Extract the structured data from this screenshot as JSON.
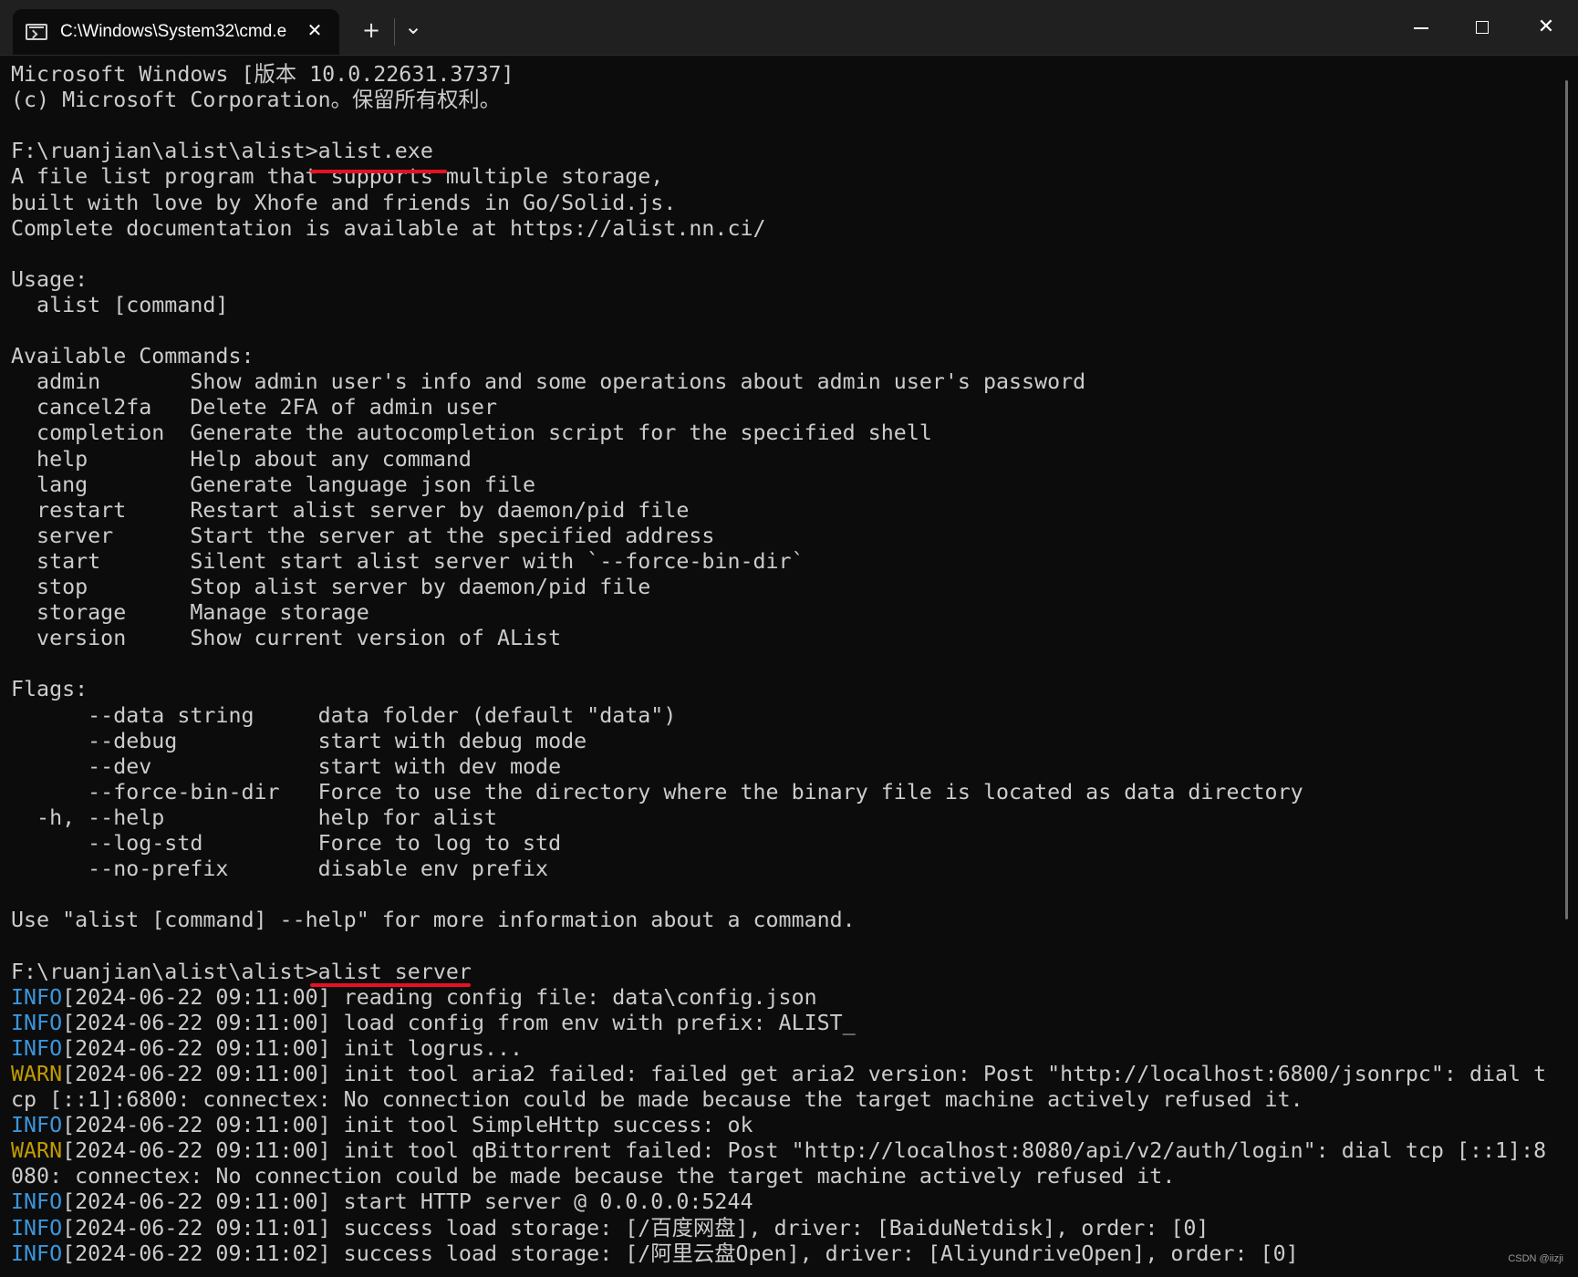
{
  "window": {
    "tab_title": "C:\\Windows\\System32\\cmd.e",
    "tab_close": "✕",
    "new_tab": "+",
    "dropdown": "⌄",
    "close": "✕"
  },
  "colors": {
    "background": "#0c0c0c",
    "text": "#cccccc",
    "info": "#3a96dd",
    "warn": "#c19c00",
    "highlight": "#e81123"
  },
  "terminal": {
    "lines": [
      {
        "text": "Microsoft Windows [版本 10.0.22631.3737]"
      },
      {
        "text": "(c) Microsoft Corporation。保留所有权利。"
      },
      {
        "text": ""
      },
      {
        "text": "F:\\ruanjian\\alist\\alist>alist.exe"
      },
      {
        "text": "A file list program that supports multiple storage,"
      },
      {
        "text": "built with love by Xhofe and friends in Go/Solid.js."
      },
      {
        "text": "Complete documentation is available at https://alist.nn.ci/"
      },
      {
        "text": ""
      },
      {
        "text": "Usage:"
      },
      {
        "text": "  alist [command]"
      },
      {
        "text": ""
      },
      {
        "text": "Available Commands:"
      },
      {
        "text": "  admin       Show admin user's info and some operations about admin user's password"
      },
      {
        "text": "  cancel2fa   Delete 2FA of admin user"
      },
      {
        "text": "  completion  Generate the autocompletion script for the specified shell"
      },
      {
        "text": "  help        Help about any command"
      },
      {
        "text": "  lang        Generate language json file"
      },
      {
        "text": "  restart     Restart alist server by daemon/pid file"
      },
      {
        "text": "  server      Start the server at the specified address"
      },
      {
        "text": "  start       Silent start alist server with `--force-bin-dir`"
      },
      {
        "text": "  stop        Stop alist server by daemon/pid file"
      },
      {
        "text": "  storage     Manage storage"
      },
      {
        "text": "  version     Show current version of AList"
      },
      {
        "text": ""
      },
      {
        "text": "Flags:"
      },
      {
        "text": "      --data string     data folder (default \"data\")"
      },
      {
        "text": "      --debug           start with debug mode"
      },
      {
        "text": "      --dev             start with dev mode"
      },
      {
        "text": "      --force-bin-dir   Force to use the directory where the binary file is located as data directory"
      },
      {
        "text": "  -h, --help            help for alist"
      },
      {
        "text": "      --log-std         Force to log to std"
      },
      {
        "text": "      --no-prefix       disable env prefix"
      },
      {
        "text": ""
      },
      {
        "text": "Use \"alist [command] --help\" for more information about a command."
      },
      {
        "text": ""
      },
      {
        "text": "F:\\ruanjian\\alist\\alist>alist server"
      },
      {
        "level": "INFO",
        "text": "[2024-06-22 09:11:00] reading config file: data\\config.json"
      },
      {
        "level": "INFO",
        "text": "[2024-06-22 09:11:00] load config from env with prefix: ALIST_"
      },
      {
        "level": "INFO",
        "text": "[2024-06-22 09:11:00] init logrus..."
      },
      {
        "level": "WARN",
        "text": "[2024-06-22 09:11:00] init tool aria2 failed: failed get aria2 version: Post \"http://localhost:6800/jsonrpc\": dial t"
      },
      {
        "text": "cp [::1]:6800: connectex: No connection could be made because the target machine actively refused it."
      },
      {
        "level": "INFO",
        "text": "[2024-06-22 09:11:00] init tool SimpleHttp success: ok"
      },
      {
        "level": "WARN",
        "text": "[2024-06-22 09:11:00] init tool qBittorrent failed: Post \"http://localhost:8080/api/v2/auth/login\": dial tcp [::1]:8"
      },
      {
        "text": "080: connectex: No connection could be made because the target machine actively refused it."
      },
      {
        "level": "INFO",
        "text": "[2024-06-22 09:11:00] start HTTP server @ 0.0.0.0:5244"
      },
      {
        "level": "INFO",
        "text": "[2024-06-22 09:11:01] success load storage: [/百度网盘], driver: [BaiduNetdisk], order: [0]"
      },
      {
        "level": "INFO",
        "text": "[2024-06-22 09:11:02] success load storage: [/阿里云盘Open], driver: [AliyundriveOpen], order: [0]"
      }
    ]
  },
  "watermark": "CSDN @iizji"
}
